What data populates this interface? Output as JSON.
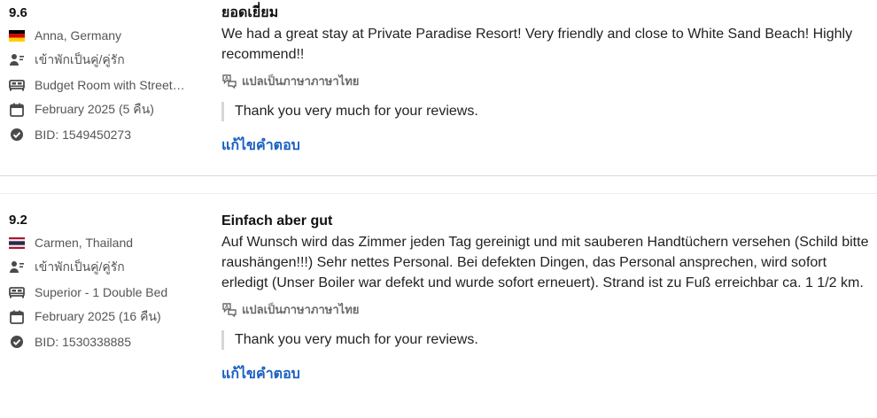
{
  "reviews": [
    {
      "score": "9.6",
      "reviewer": "Anna, Germany",
      "flag": "germany-flag",
      "traveler_type": "เข้าพักเป็นคู่/คู่รัก",
      "room": "Budget Room with Street…",
      "stay": "February 2025 (5 คืน)",
      "bid": "BID: 1549450273",
      "title": "ยอดเยี่ยม",
      "body": "We had a great stay at Private Paradise Resort! Very friendly and close to White Sand Beach! Highly recommend!!",
      "translate_label": "แปลเป็นภาษาภาษาไทย",
      "reply": "Thank you very much for your reviews.",
      "edit_label": "แก้ไขคำตอบ"
    },
    {
      "score": "9.2",
      "reviewer": "Carmen, Thailand",
      "flag": "thailand-flag",
      "traveler_type": "เข้าพักเป็นคู่/คู่รัก",
      "room": "Superior - 1 Double Bed",
      "stay": "February 2025 (16 คืน)",
      "bid": "BID: 1530338885",
      "title": "Einfach aber gut",
      "body": "Auf Wunsch wird das Zimmer jeden Tag gereinigt und mit sauberen Handtüchern versehen (Schild bitte raushängen!!!) Sehr nettes Personal. Bei defekten Dingen, das Personal ansprechen, wird sofort erledigt (Unser Boiler war defekt und wurde sofort erneuert). Strand ist zu Fuß erreichbar ca. 1 1/2 km.",
      "translate_label": "แปลเป็นภาษาภาษาไทย",
      "reply": "Thank you very much for your reviews.",
      "edit_label": "แก้ไขคำตอบ"
    }
  ],
  "icons": {
    "traveler": "couple-icon",
    "room": "bed-icon",
    "stay": "calendar-icon",
    "bid": "check-circle-icon",
    "translate": "translate-icon"
  },
  "colors": {
    "link": "#1a5fc2",
    "meta_text": "#555555",
    "icon": "#4a4a4a"
  }
}
